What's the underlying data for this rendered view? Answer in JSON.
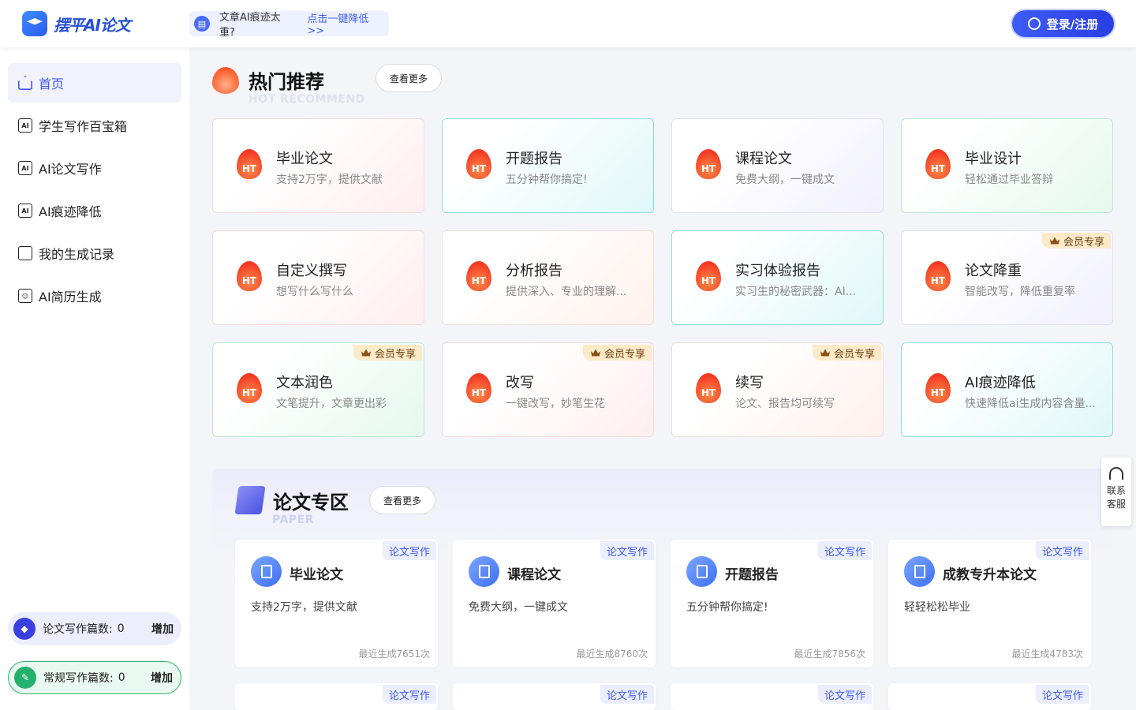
{
  "header": {
    "logo_text": "摆平AI论文",
    "notice_text": "文章AI痕迹太重?",
    "notice_link": "点击一键降低 >>",
    "login_label": "登录/注册"
  },
  "sidebar": {
    "items": [
      {
        "label": "首页",
        "icon": "home-icon",
        "active": true
      },
      {
        "label": "学生写作百宝箱",
        "icon": "ai-book-icon"
      },
      {
        "label": "AI论文写作",
        "icon": "ai-book-icon"
      },
      {
        "label": "AI痕迹降低",
        "icon": "ai-doc-icon"
      },
      {
        "label": "我的生成记录",
        "icon": "record-icon"
      },
      {
        "label": "AI简历生成",
        "icon": "resume-icon"
      }
    ],
    "counters": [
      {
        "label": "论文写作篇数:",
        "value": "0",
        "action": "增加"
      },
      {
        "label": "常规写作篇数:",
        "value": "0",
        "action": "增加"
      }
    ]
  },
  "hot": {
    "title": "热门推荐",
    "subtitle": "HOT RECOMMEND",
    "more_label": "查看更多",
    "badge_text": "HT",
    "vip_text": "会员专享",
    "cards": [
      {
        "title": "毕业论文",
        "desc": "支持2万字，提供文献",
        "vip": false
      },
      {
        "title": "开题报告",
        "desc": "五分钟帮你搞定!",
        "vip": false
      },
      {
        "title": "课程论文",
        "desc": "免费大纲，一键成文",
        "vip": false
      },
      {
        "title": "毕业设计",
        "desc": "轻松通过毕业答辩",
        "vip": false
      },
      {
        "title": "自定义撰写",
        "desc": "想写什么写什么",
        "vip": false
      },
      {
        "title": "分析报告",
        "desc": "提供深入、专业的理解...",
        "vip": false
      },
      {
        "title": "实习体验报告",
        "desc": "实习生的秘密武器：AI...",
        "vip": false
      },
      {
        "title": "论文降重",
        "desc": "智能改写，降低重复率",
        "vip": true
      },
      {
        "title": "文本润色",
        "desc": "文笔提升，文章更出彩",
        "vip": true
      },
      {
        "title": "改写",
        "desc": "一键改写，妙笔生花",
        "vip": true
      },
      {
        "title": "续写",
        "desc": "论文、报告均可续写",
        "vip": true
      },
      {
        "title": "AI痕迹降低",
        "desc": "快速降低ai生成内容含量...",
        "vip": false
      }
    ]
  },
  "paper": {
    "title": "论文专区",
    "subtitle": "PAPER",
    "more_label": "查看更多",
    "tag": "论文写作",
    "cards": [
      {
        "title": "毕业论文",
        "desc": "支持2万字，提供文献",
        "count": "最近生成7651次"
      },
      {
        "title": "课程论文",
        "desc": "免费大纲，一键成文",
        "count": "最近生成8760次"
      },
      {
        "title": "开题报告",
        "desc": "五分钟帮你搞定!",
        "count": "最近生成7856次"
      },
      {
        "title": "成教专升本论文",
        "desc": "轻轻松松毕业",
        "count": "最近生成4783次"
      }
    ]
  },
  "service": {
    "label": "联系客服"
  }
}
